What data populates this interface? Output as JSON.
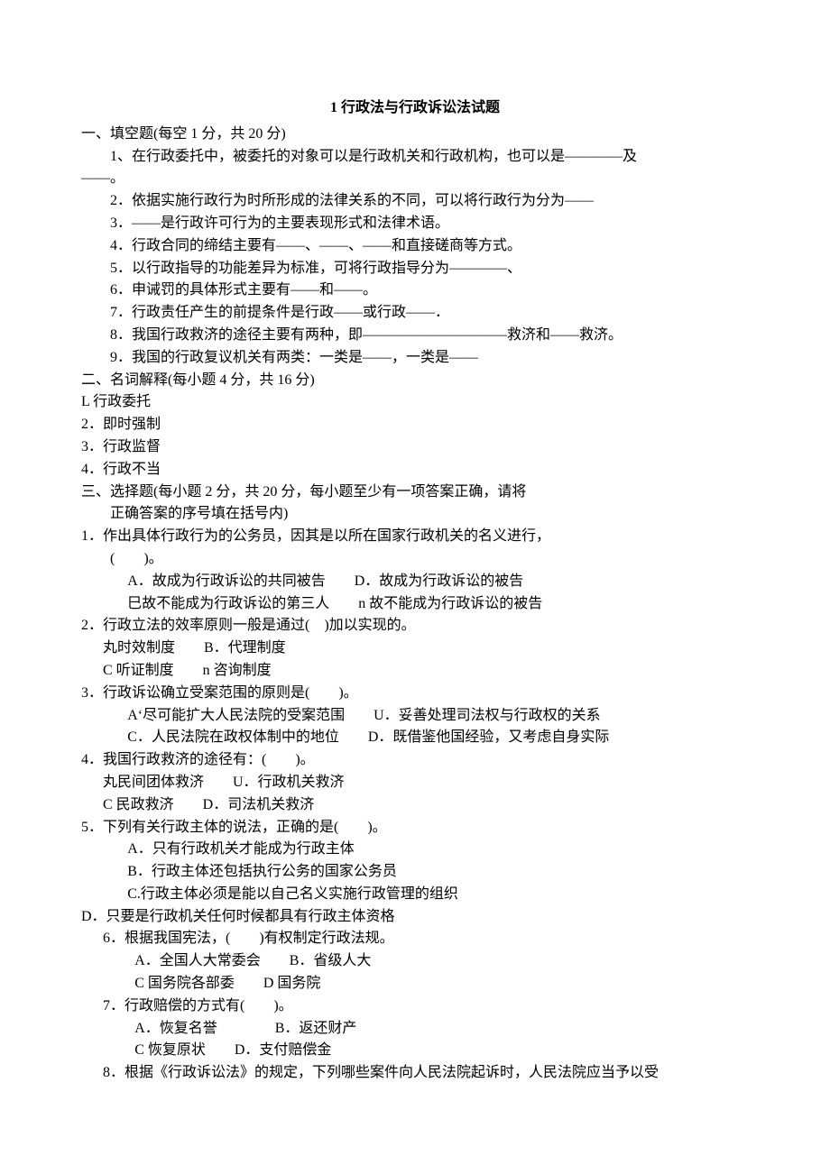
{
  "title": "1 行政法与行政诉讼法试题",
  "s1_heading": "一、填空题(每空 1 分，共 20 分)",
  "q1_1": "1、在行政委托中，被委托的对象可以是行政机关和行政机构，也可以是————及",
  "q1_1b": "——。",
  "q1_2": "2．依据实施行政行为时所形成的法律关系的不同，可以将行政行为分为——",
  "q1_3": "3．——是行政许可行为的主要表现形式和法律术语。",
  "q1_4": "4．行政合同的缔结主要有——、——、——和直接磋商等方式。",
  "q1_5": "5．以行政指导的功能差异为标准，可将行政指导分为————、",
  "q1_6": "6．申诫罚的具体形式主要有——和——。",
  "q1_7": "7．行政责任产生的前提条件是行政——或行政——．",
  "q1_8": "8．我国行政救济的途径主要有两种，即——————————救济和——救济。",
  "q1_9": "9．我国的行政复议机关有两类：一类是——，一类是——",
  "s2_heading": "二、名词解释(每小题 4 分，共 16 分)",
  "t2_1": "L 行政委托",
  "t2_2": "2．即时强制",
  "t2_3": "3．行政监督",
  "t2_4": "4．行政不当",
  "s3_heading": "三、选择题(每小题 2 分，共 20 分，每小题至少有一项答案正确，请将",
  "s3_heading2": "正确答案的序号填在括号内)",
  "q3_1": "1．作出具体行政行为的公务员，因其是以所在国家行政机关的名义进行，",
  "q3_1b": "(　　)。",
  "q3_1c": "A．故成为行政诉讼的共同被告　　D．故成为行政诉讼的被告",
  "q3_1d": "巳故不能成为行政诉讼的第三人　　n 故不能成为行政诉讼的被告",
  "q3_2": "2．行政立法的效率原则一般是通过(　)加以实现的。",
  "q3_2b": "丸时效制度　　B．代理制度",
  "q3_2c": "C 听证制度　　n 咨询制度",
  "q3_3": "3．行政诉讼确立受案范围的原则是(　　)。",
  "q3_3b": "A‘尽可能扩大人民法院的受案范围　　U．妥善处理司法权与行政权的关系",
  "q3_3c": "C．人民法院在政权体制中的地位　　D．既借鉴他国经验，又考虑自身实际",
  "q3_4": "4．我国行政救济的途径有：(　　)。",
  "q3_4b": "丸民间团体救济　　U．行政机关救济",
  "q3_4c": "C 民政救济　　D．司法机关救济",
  "q3_5": "5．下列有关行政主体的说法，正确的是(　　)。",
  "q3_5b": "A．只有行政机关才能成为行政主体",
  "q3_5c": "B．行政主体还包括执行公务的国家公务员",
  "q3_5d": "C.行政主体必须是能以自己名义实施行政管理的组织",
  "q3_5e": "D．只要是行政机关任何时候都具有行政主体资格",
  "q3_6": "6．根据我国宪法，(　　)有权制定行政法规。",
  "q3_6b": "A．全国人大常委会　　B．省级人大",
  "q3_6c": "C 国务院各部委　　D 国务院",
  "q3_7": "7．行政赔偿的方式有(　　)。",
  "q3_7b": "A．恢复名誉　　　　B．返还财产",
  "q3_7c": "C 恢复原状　　D．支付赔偿金",
  "q3_8": "8．根据《行政诉讼法》的规定，下列哪些案件向人民法院起诉时，人民法院应当予以受"
}
